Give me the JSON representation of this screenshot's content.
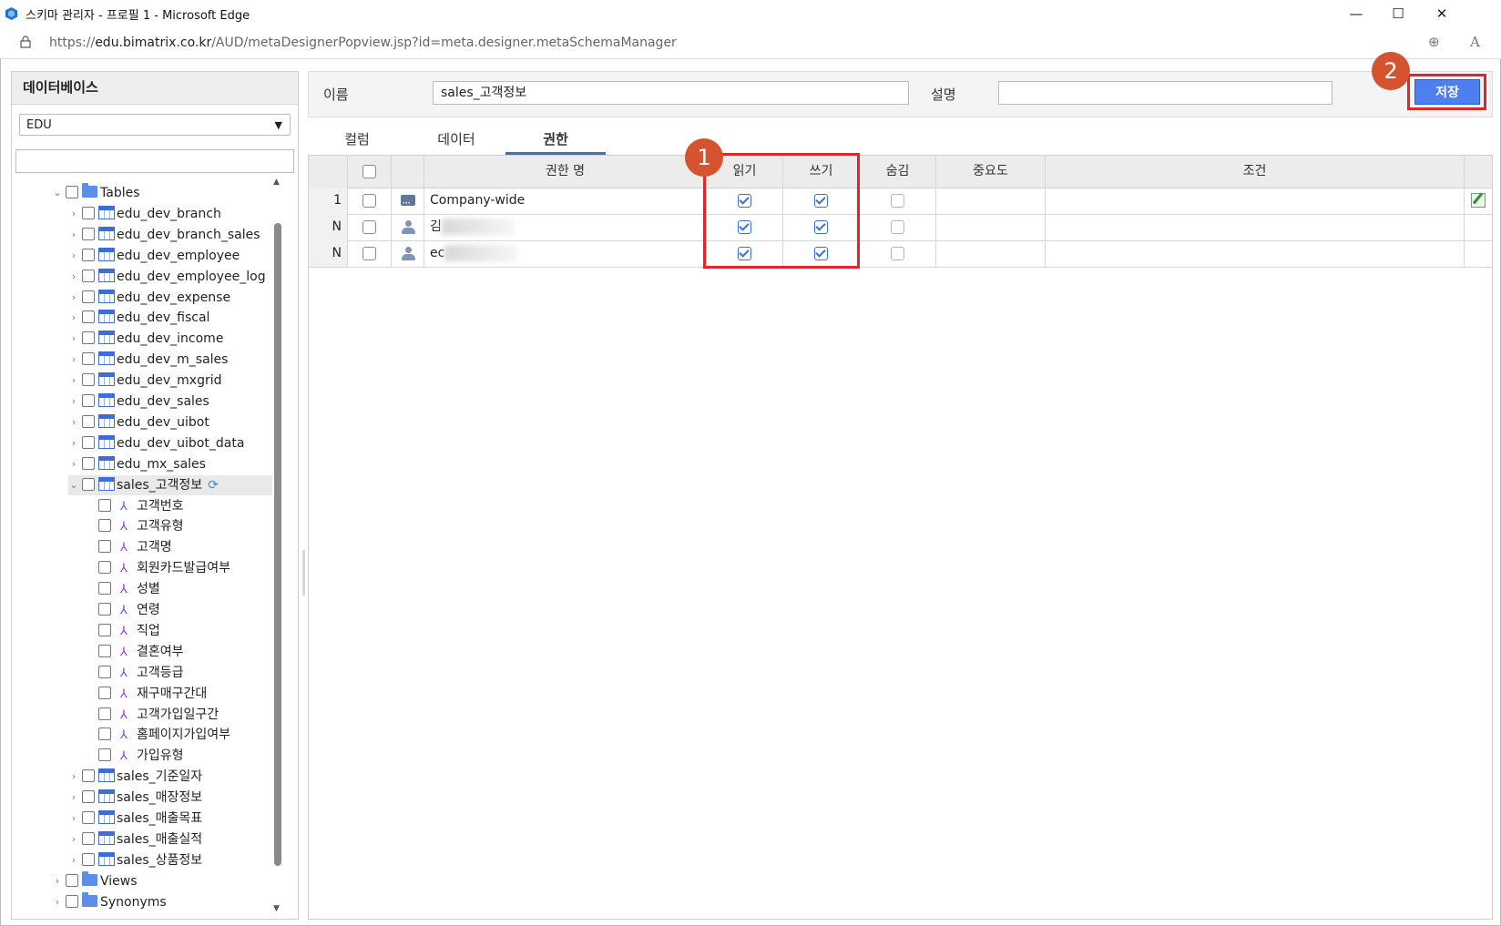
{
  "window": {
    "title": "스키마 관리자 - 프로필 1 - Microsoft Edge",
    "minimize": "—",
    "maximize": "☐",
    "close": "✕"
  },
  "address": {
    "url_prefix": "https://",
    "url_domain": "edu.bimatrix.co.kr",
    "url_path": "/AUD/metaDesignerPopview.jsp?id=meta.designer.metaSchemaManager",
    "zoom_icon": "⊕",
    "read_aloud_icon": "A"
  },
  "sidebar": {
    "header": "데이터베이스",
    "db_select": "EDU",
    "search_value": "",
    "tree": {
      "tables_label": "Tables",
      "tables": [
        "edu_dev_branch",
        "edu_dev_branch_sales",
        "edu_dev_employee",
        "edu_dev_employee_log",
        "edu_dev_expense",
        "edu_dev_fiscal",
        "edu_dev_income",
        "edu_dev_m_sales",
        "edu_dev_mxgrid",
        "edu_dev_sales",
        "edu_dev_uibot",
        "edu_dev_uibot_data",
        "edu_mx_sales"
      ],
      "expanded_table": "sales_고객정보",
      "columns": [
        "고객번호",
        "고객유형",
        "고객명",
        "회원카드발급여부",
        "성별",
        "연령",
        "직업",
        "결혼여부",
        "고객등급",
        "재구매구간대",
        "고객가입일구간",
        "홈페이지가입여부",
        "가입유형"
      ],
      "tables_after": [
        "sales_기준일자",
        "sales_매장정보",
        "sales_매출목표",
        "sales_매출실적",
        "sales_상품정보"
      ],
      "views_label": "Views",
      "synonyms_label": "Synonyms"
    }
  },
  "form": {
    "name_label": "이름",
    "name_value": "sales_고객정보",
    "desc_label": "설명",
    "desc_value": "",
    "save_label": "저장"
  },
  "tabs": [
    "컬럼",
    "데이터",
    "권한"
  ],
  "active_tab": "권한",
  "grid": {
    "headers": [
      "",
      "",
      "",
      "권한 명",
      "읽기",
      "쓰기",
      "숨김",
      "중요도",
      "조건",
      ""
    ],
    "rows": [
      {
        "num": "1",
        "name": "Company-wide",
        "read": true,
        "write": true,
        "hide": false,
        "icon": "group"
      },
      {
        "num": "N",
        "name": "김",
        "read": true,
        "write": true,
        "hide": false,
        "icon": "user"
      },
      {
        "num": "N",
        "name": "ec",
        "read": true,
        "write": true,
        "hide": false,
        "icon": "user"
      }
    ]
  },
  "annotations": {
    "badge1": "1",
    "badge2": "2",
    "accent": "#e0262a",
    "badge_color": "#d5542f"
  }
}
